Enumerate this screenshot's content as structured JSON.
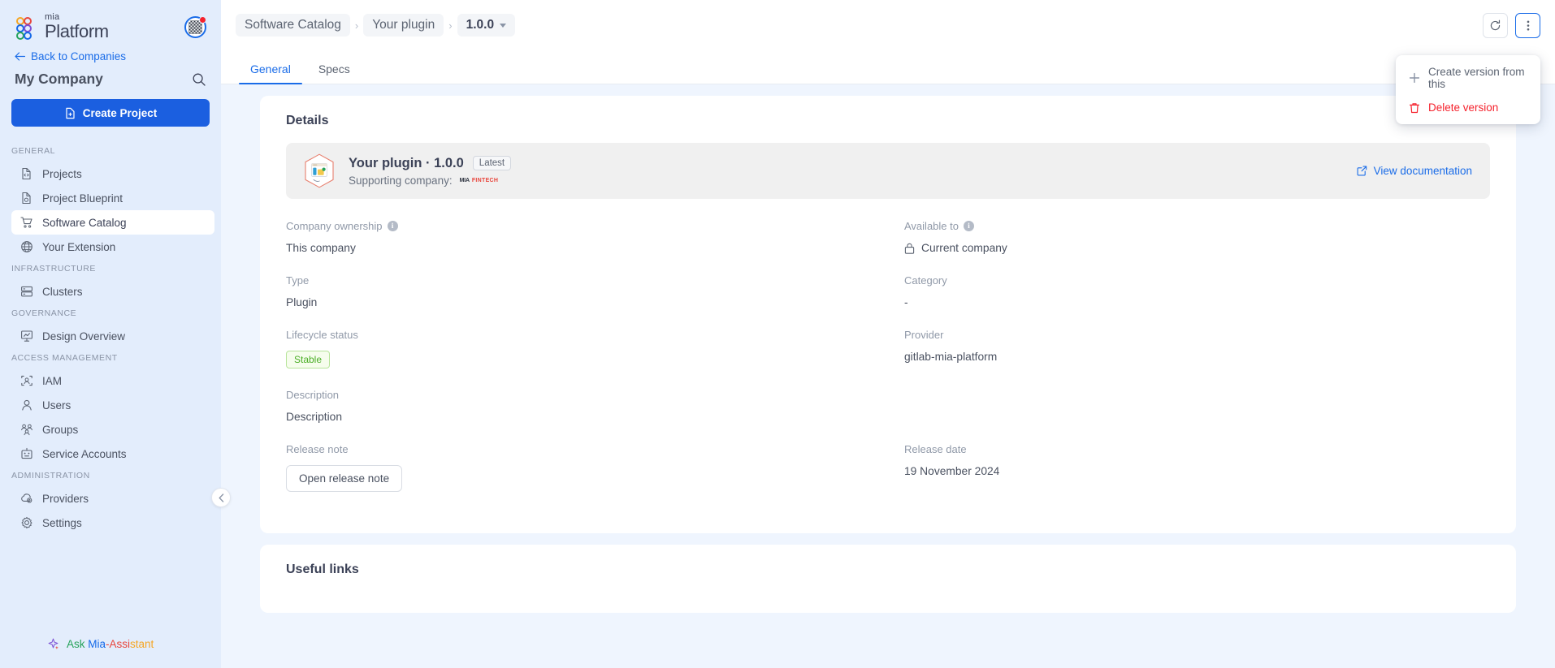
{
  "brand": {
    "mia": "mia",
    "platform": "Platform"
  },
  "sidebar": {
    "back_label": "Back to Companies",
    "company_name": "My Company",
    "create_button": "Create Project",
    "sections": [
      {
        "title": "GENERAL",
        "items": [
          {
            "label": "Projects",
            "icon": "file-code-icon",
            "active": false
          },
          {
            "label": "Project Blueprint",
            "icon": "blueprint-icon",
            "active": false
          },
          {
            "label": "Software Catalog",
            "icon": "cart-icon",
            "active": true
          },
          {
            "label": "Your Extension",
            "icon": "globe-icon",
            "active": false
          }
        ]
      },
      {
        "title": "INFRASTRUCTURE",
        "items": [
          {
            "label": "Clusters",
            "icon": "server-icon",
            "active": false
          }
        ]
      },
      {
        "title": "GOVERNANCE",
        "items": [
          {
            "label": "Design Overview",
            "icon": "presentation-icon",
            "active": false
          }
        ]
      },
      {
        "title": "ACCESS MANAGEMENT",
        "items": [
          {
            "label": "IAM",
            "icon": "iam-icon",
            "active": false
          },
          {
            "label": "Users",
            "icon": "user-icon",
            "active": false
          },
          {
            "label": "Groups",
            "icon": "groups-icon",
            "active": false
          },
          {
            "label": "Service Accounts",
            "icon": "robot-icon",
            "active": false
          }
        ]
      },
      {
        "title": "ADMINISTRATION",
        "items": [
          {
            "label": "Providers",
            "icon": "cloud-gear-icon",
            "active": false
          },
          {
            "label": "Settings",
            "icon": "gear-icon",
            "active": false
          }
        ]
      }
    ],
    "assistant_label_parts": [
      "Ask ",
      "Mia",
      "-",
      "Assi",
      "stant"
    ],
    "assistant_label": "Ask Mia-Assistant"
  },
  "breadcrumb": {
    "items": [
      "Software Catalog",
      "Your plugin"
    ],
    "version": "1.0.0",
    "separator": "›"
  },
  "tabs": [
    {
      "label": "General",
      "active": true
    },
    {
      "label": "Specs",
      "active": false
    }
  ],
  "top_actions": {
    "refresh_icon": "refresh-icon",
    "more_icon": "more-vertical-icon"
  },
  "dropdown": {
    "open": true,
    "items": [
      {
        "label": "Create version from this",
        "icon": "plus-icon",
        "danger": false
      },
      {
        "label": "Delete version",
        "icon": "trash-icon",
        "danger": true
      }
    ]
  },
  "details": {
    "card_title": "Details",
    "banner": {
      "title": "Your plugin · 1.0.0",
      "badge": "Latest",
      "supporting_label": "Supporting company:",
      "supporting_company": "MIA FINTECH",
      "supporting_mark": "MIA",
      "supporting_word": "FINTECH",
      "doc_link": "View documentation"
    },
    "fields": [
      {
        "label": "Company ownership",
        "info": true,
        "value": "This company",
        "kind": "text"
      },
      {
        "label": "Available to",
        "info": true,
        "value": "Current company",
        "kind": "lock"
      },
      {
        "label": "Type",
        "info": false,
        "value": "Plugin",
        "kind": "text"
      },
      {
        "label": "Category",
        "info": false,
        "value": "-",
        "kind": "text"
      },
      {
        "label": "Lifecycle status",
        "info": false,
        "value": "Stable",
        "kind": "chip"
      },
      {
        "label": "Provider",
        "info": false,
        "value": "gitlab-mia-platform",
        "kind": "text"
      },
      {
        "label": "Description",
        "info": false,
        "value": "Description",
        "kind": "text"
      },
      {
        "label": "",
        "info": false,
        "value": "",
        "kind": "empty"
      },
      {
        "label": "Release note",
        "info": false,
        "value": "Open release note",
        "kind": "button"
      },
      {
        "label": "Release date",
        "info": false,
        "value": "19 November 2024",
        "kind": "text"
      }
    ]
  },
  "useful_links": {
    "card_title": "Useful links"
  },
  "colors": {
    "accent": "#1a6ce8",
    "primary_button": "#1b5fe0",
    "sidebar_bg": "#e3edfc",
    "content_bg": "#eff5fe",
    "danger": "#f5222d",
    "stable_green": "#4caf27"
  }
}
